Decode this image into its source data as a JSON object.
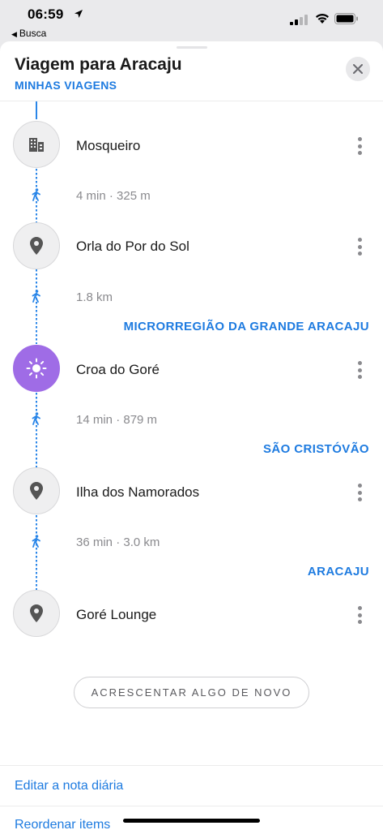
{
  "status_bar": {
    "time": "06:59",
    "back_label": "Busca"
  },
  "header": {
    "title": "Viagem para Aracaju",
    "subtitle": "MINHAS VIAGENS"
  },
  "stops": [
    {
      "name": "Mosqueiro",
      "icon": "building-icon"
    },
    {
      "name": "Orla do Por do Sol",
      "icon": "pin-icon"
    },
    {
      "name": "Croa do Goré",
      "icon": "sun-icon"
    },
    {
      "name": "Ilha dos Namorados",
      "icon": "pin-icon"
    },
    {
      "name": "Goré Lounge",
      "icon": "pin-icon"
    }
  ],
  "segments": [
    {
      "travel": "4 min · 325 m",
      "mode": "walk"
    },
    {
      "travel": "1.8 km",
      "mode": "walk"
    },
    {
      "travel": "14 min · 879 m",
      "mode": "walk"
    },
    {
      "travel": "36 min · 3.0 km",
      "mode": "walk"
    }
  ],
  "regions": [
    "MICRORREGIÃO DA GRANDE ARACAJU",
    "SÃO CRISTÓVÃO",
    "ARACAJU"
  ],
  "add_button": "ACRESCENTAR ALGO DE NOVO",
  "bottom_links": [
    "Editar a nota diária",
    "Reordenar items"
  ],
  "colors": {
    "accent": "#1e7be0",
    "active_stop": "#9f6ce6"
  }
}
